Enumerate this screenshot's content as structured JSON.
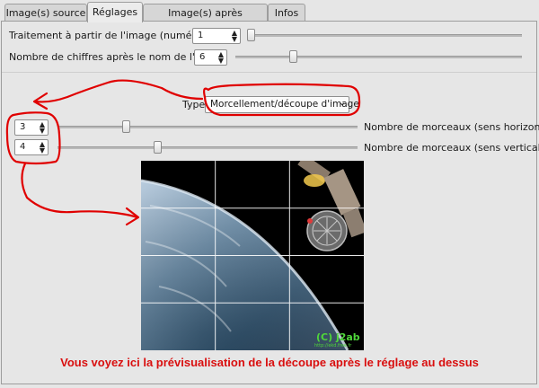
{
  "tabs": [
    {
      "label": "Image(s) source",
      "active": false
    },
    {
      "label": "Réglages",
      "active": true
    },
    {
      "label": "Image(s) après traitement",
      "active": false
    },
    {
      "label": "Infos",
      "active": false
    }
  ],
  "settings": {
    "start_image": {
      "label": "Traitement à partir de l'image (numéro)",
      "value": "1"
    },
    "digits": {
      "label": "Nombre de chiffres après le nom de l'image",
      "value": "6"
    }
  },
  "type_selector": {
    "label": "Type",
    "value": "Morcellement/découpe d'image"
  },
  "pieces": {
    "horizontal": {
      "value": "3",
      "label": "Nombre de morceaux (sens horizontal)"
    },
    "vertical": {
      "value": "4",
      "label": "Nombre de morceaux (sens vertical)"
    }
  },
  "preview": {
    "watermark": "(C)  j2ab",
    "watermark_url": "http://ekd.free.fr"
  },
  "annotation": {
    "caption": "Vous voyez ici la prévisualisation de la découpe après le réglage au dessus",
    "color": "#e00000"
  },
  "colors": {
    "annotation_red": "#e00000",
    "watermark_green": "#4fd63a"
  }
}
